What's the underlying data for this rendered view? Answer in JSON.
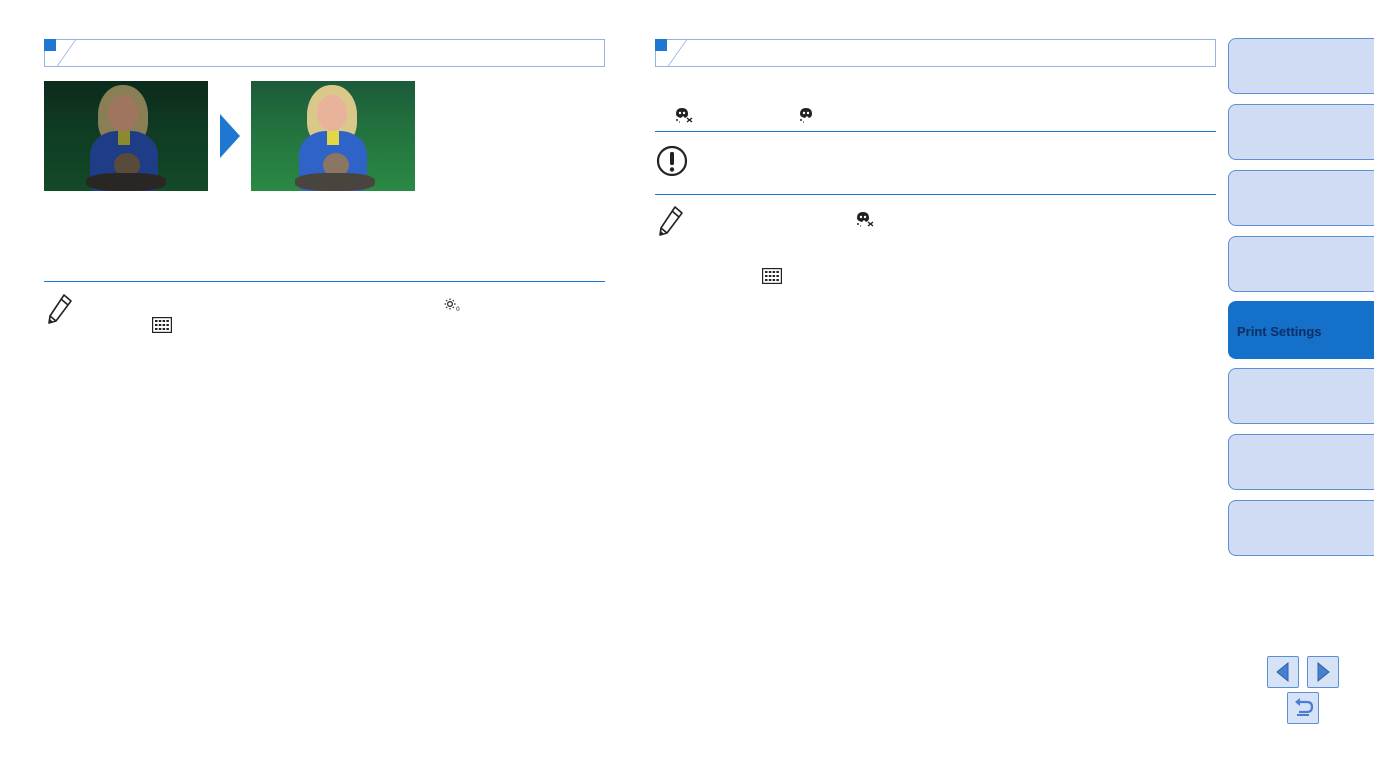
{
  "sidebar": {
    "tabs": [
      {
        "label": ""
      },
      {
        "label": ""
      },
      {
        "label": ""
      },
      {
        "label": ""
      },
      {
        "label": "Print Settings"
      },
      {
        "label": ""
      },
      {
        "label": ""
      },
      {
        "label": ""
      }
    ]
  },
  "colors": {
    "accent": "#1e78d2",
    "tab_fill": "#cfdcf4",
    "tab_active": "#1470c8",
    "tab_border": "#5e8fd4"
  },
  "icons": {
    "section_marker": "blue-square-icon",
    "compare_arrow": "play-arrow-icon",
    "memo": "pencil-icon",
    "caution": "exclamation-circle-icon",
    "red_eye_off": "red-eye-off-icon",
    "red_eye_on": "red-eye-on-icon",
    "brightness": "brightness-icon",
    "grid": "grid-icon",
    "prev": "arrow-left-icon",
    "next": "arrow-right-icon",
    "back": "return-icon"
  }
}
